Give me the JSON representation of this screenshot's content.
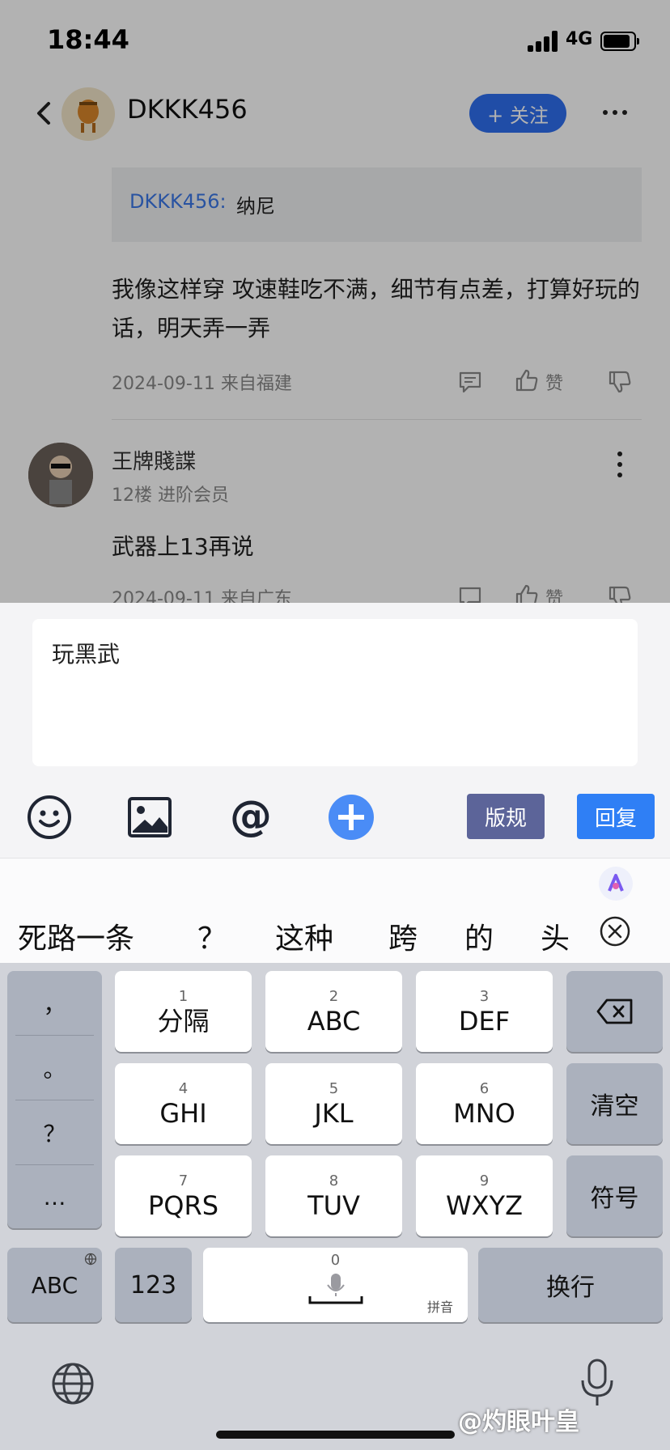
{
  "status_bar": {
    "time": "18:44",
    "network": "4G"
  },
  "nav": {
    "title": "DKKK456",
    "follow_label": "+ 关注"
  },
  "quote": {
    "author": "DKKK456:",
    "text": "纳尼"
  },
  "comment1": {
    "text": "我像这样穿 攻速鞋吃不满，细节有点差，打算好玩的话，明天弄一弄",
    "meta": "2024-09-11 来自福建",
    "like_label": "赞"
  },
  "comment2": {
    "author": "王牌賤諜",
    "floor": "12楼 进阶会员",
    "text": "武器上13再说",
    "meta": "2024-09-11 来自广东",
    "like_label": "赞"
  },
  "composer": {
    "value": "玩黑武",
    "rules_label": "版规",
    "reply_label": "回复"
  },
  "candidates": [
    "死路一条",
    "？",
    "这种",
    "跨",
    "的",
    "头"
  ],
  "keyboard": {
    "punct": [
      "，",
      "。",
      "？",
      "…"
    ],
    "keys": [
      {
        "num": "1",
        "label": "分隔"
      },
      {
        "num": "2",
        "label": "ABC"
      },
      {
        "num": "3",
        "label": "DEF"
      },
      {
        "num": "4",
        "label": "GHI"
      },
      {
        "num": "5",
        "label": "JKL"
      },
      {
        "num": "6",
        "label": "MNO"
      },
      {
        "num": "7",
        "label": "PQRS"
      },
      {
        "num": "8",
        "label": "TUV"
      },
      {
        "num": "9",
        "label": "WXYZ"
      }
    ],
    "clear_label": "清空",
    "symbol_label": "符号",
    "abc_label": "ABC",
    "num_label": "123",
    "space_num": "0",
    "space_hint": "拼音",
    "enter_label": "换行"
  },
  "watermark": "@灼眼叶皇",
  "colors": {
    "accent": "#2f6ff0",
    "reply": "#2f7ff5",
    "rules": "#5c6499",
    "link": "#3b78e7"
  }
}
